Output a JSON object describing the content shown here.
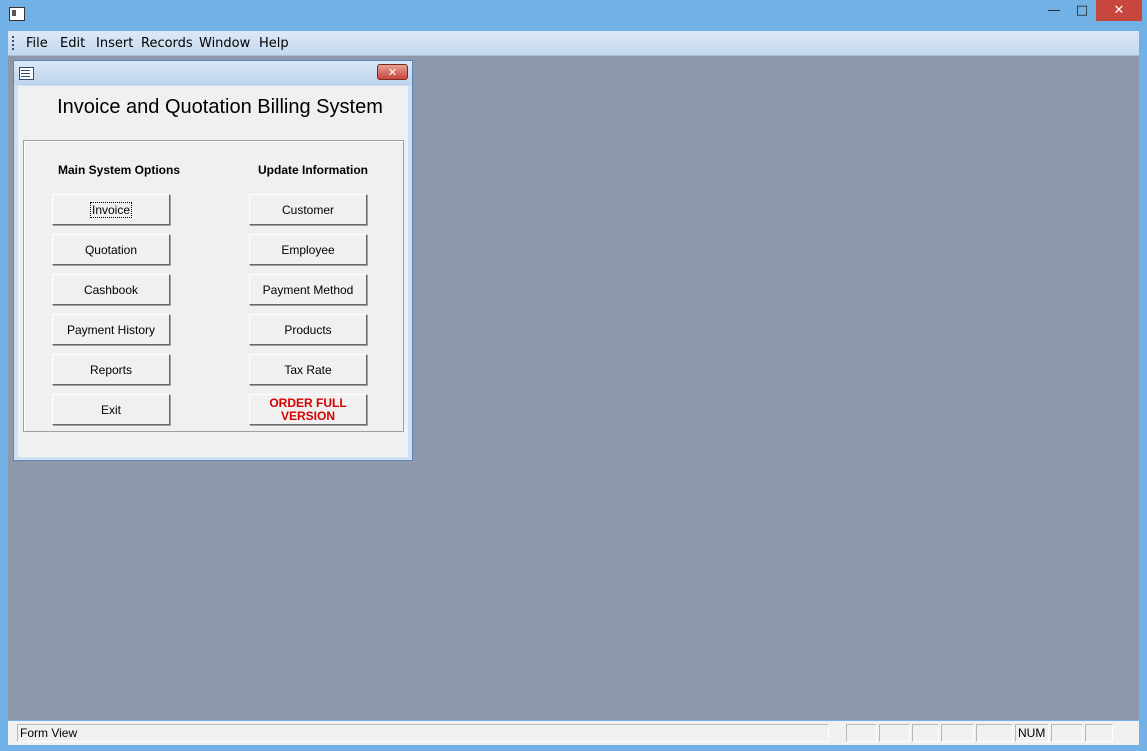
{
  "menubar": {
    "items": [
      "File",
      "Edit",
      "Insert",
      "Records",
      "Window",
      "Help"
    ]
  },
  "form": {
    "title": "Invoice and Quotation Billing System",
    "left_heading": "Main System Options",
    "right_heading": "Update Information",
    "left_buttons": [
      "Invoice",
      "Quotation",
      "Cashbook",
      "Payment History",
      "Reports",
      "Exit"
    ],
    "right_buttons": [
      "Customer",
      "Employee",
      "Payment Method",
      "Products",
      "Tax Rate"
    ],
    "order_button": "ORDER FULL VERSION",
    "focused_button": "Invoice"
  },
  "statusbar": {
    "view_label": "Form View",
    "num_indicator": "NUM"
  },
  "window_controls": {
    "close_glyph": "✕"
  }
}
